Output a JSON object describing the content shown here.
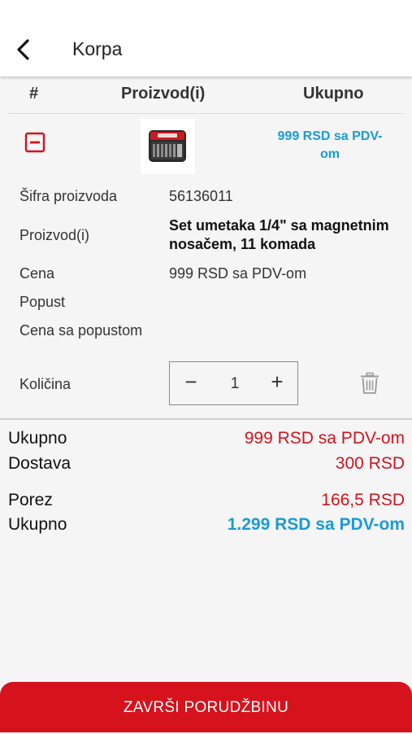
{
  "header": {
    "title": "Korpa",
    "back_icon": "chevron-left-icon"
  },
  "table": {
    "columns": [
      "#",
      "Proizvod(i)",
      "Ukupno"
    ],
    "row": {
      "remove_icon": "minus-square-icon",
      "price": "999 RSD sa PDV-om"
    }
  },
  "details": {
    "code_label": "Šifra proizvoda",
    "code_value": "56136011",
    "product_label": "Proizvod(i)",
    "product_value": "Set umetaka 1/4\" sa magnetnim nosačem, 11 komada",
    "price_label": "Cena",
    "price_value": "999 RSD sa PDV-om",
    "discount_label": "Popust",
    "discounted_label": "Cena sa popustom",
    "qty_label": "Količina",
    "qty_value": "1",
    "qty_minus": "−",
    "qty_plus": "+",
    "trash_icon": "trash-icon"
  },
  "summary": {
    "subtotal_label": "Ukupno",
    "subtotal_value": "999 RSD sa PDV-om",
    "shipping_label": "Dostava",
    "shipping_value": "300 RSD",
    "tax_label": "Porez",
    "tax_value": "166,5 RSD",
    "total_label": "Ukupno",
    "total_value": "1.299 RSD sa PDV-om"
  },
  "actions": {
    "finish_label": "ZAVRŠI PORUDŽBINU"
  },
  "colors": {
    "accent_red": "#d6121c",
    "price_blue": "#1a9bd7",
    "text_red": "#d0151e"
  }
}
